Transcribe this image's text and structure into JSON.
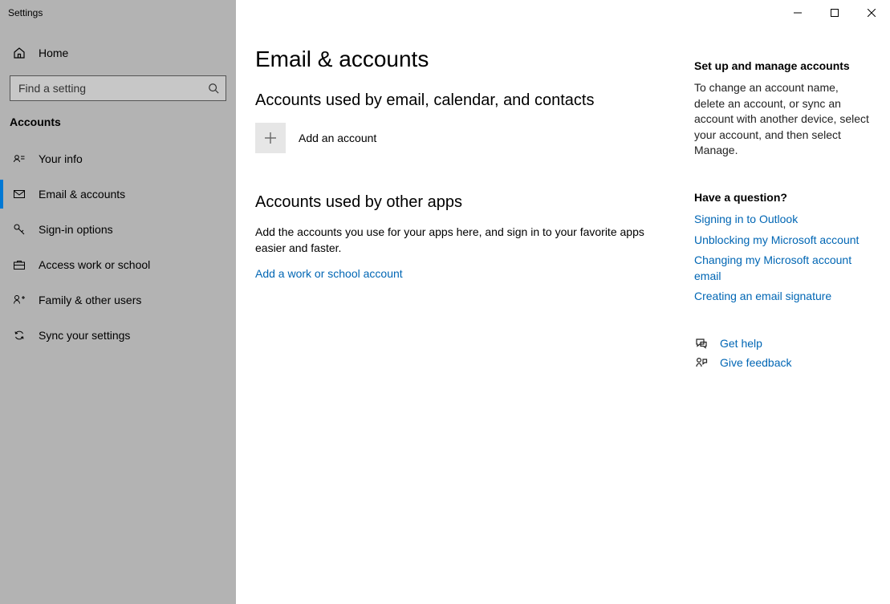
{
  "window": {
    "title": "Settings"
  },
  "sidebar": {
    "home": "Home",
    "search_placeholder": "Find a setting",
    "section": "Accounts",
    "items": [
      {
        "label": "Your info"
      },
      {
        "label": "Email & accounts"
      },
      {
        "label": "Sign-in options"
      },
      {
        "label": "Access work or school"
      },
      {
        "label": "Family & other users"
      },
      {
        "label": "Sync your settings"
      }
    ]
  },
  "page": {
    "title": "Email & accounts",
    "section1_heading": "Accounts used by email, calendar, and contacts",
    "add_account_label": "Add an account",
    "section2_heading": "Accounts used by other apps",
    "section2_body": "Add the accounts you use for your apps here, and sign in to your favorite apps easier and faster.",
    "add_work_link": "Add a work or school account"
  },
  "rail": {
    "setup_head": "Set up and manage accounts",
    "setup_body": "To change an account name, delete an account, or sync an account with another device, select your account, and then select Manage.",
    "question_head": "Have a question?",
    "question_links": [
      "Signing in to Outlook",
      "Unblocking my Microsoft account",
      "Changing my Microsoft account email",
      "Creating an email signature"
    ],
    "get_help": "Get help",
    "give_feedback": "Give feedback"
  }
}
